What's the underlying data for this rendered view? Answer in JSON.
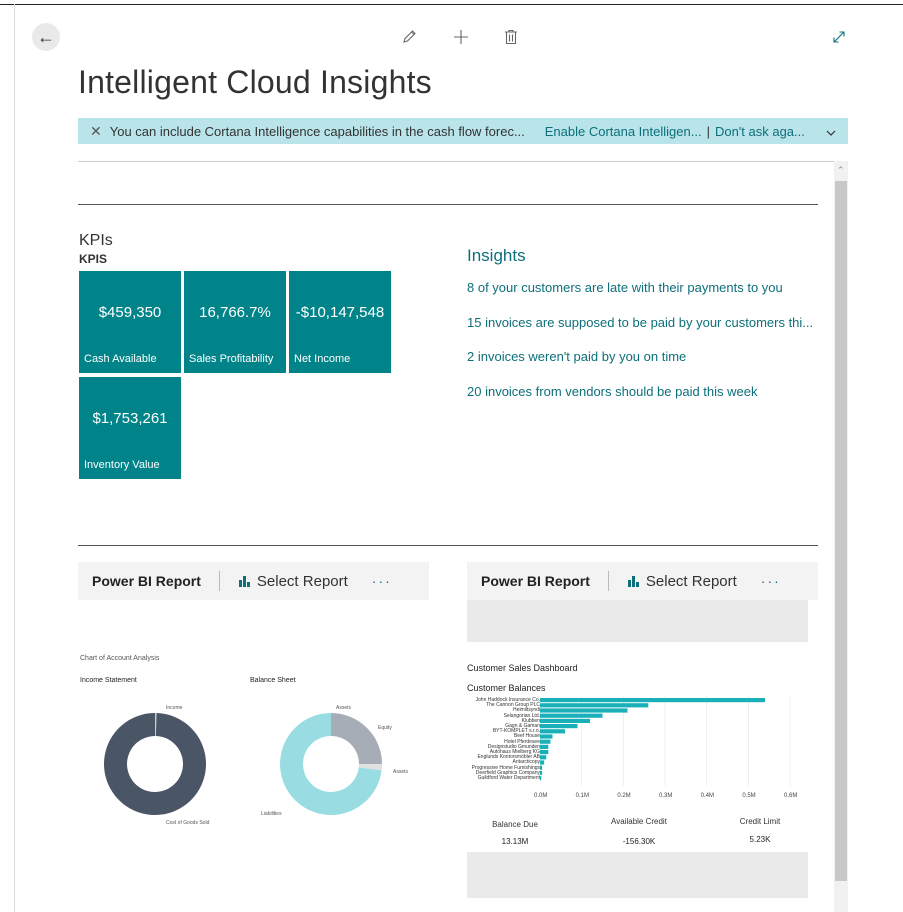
{
  "page": {
    "title": "Intelligent Cloud Insights"
  },
  "banner": {
    "message": "You can include Cortana Intelligence capabilities in the cash flow forec...",
    "enable_label": "Enable Cortana Intelligen...",
    "separator": "|",
    "dont_ask_label": "Don't ask aga..."
  },
  "kpis": {
    "heading": "KPIs",
    "subheading": "KPIS",
    "tiles": [
      {
        "value": "$459,350",
        "label": "Cash Available"
      },
      {
        "value": "16,766.7%",
        "label": "Sales Profitability"
      },
      {
        "value": "-$10,147,548",
        "label": "Net Income"
      },
      {
        "value": "$1,753,261",
        "label": "Inventory Value"
      }
    ]
  },
  "insights": {
    "heading": "Insights",
    "items": [
      "8 of your customers are late with their payments to you",
      "15 invoices are supposed to be paid by your customers thi...",
      "2 invoices weren't paid by you on time",
      "20 invoices from vendors should be paid this week"
    ]
  },
  "powerbi_left": {
    "title": "Power BI Report",
    "select_label": "Select Report",
    "more": "···",
    "report_title": "Chart of Account Analysis",
    "income_title": "Income Statement",
    "balance_title": "Balance Sheet",
    "income_labels": [
      "Income",
      "Cost of Goods Sold"
    ],
    "balance_labels": [
      "Assets",
      "Equity",
      "Assets",
      "Liabilities"
    ]
  },
  "powerbi_right": {
    "title": "Power BI Report",
    "select_label": "Select Report",
    "more": "···",
    "dashboard_title": "Customer Sales Dashboard",
    "chart_title": "Customer Balances",
    "cards": [
      {
        "label": "Balance Due",
        "value": "13.13M"
      },
      {
        "label": "Available Credit",
        "value": "-156.30K"
      },
      {
        "label": "Credit Limit",
        "value": "5.23K"
      }
    ]
  },
  "chart_data": [
    {
      "type": "bar",
      "title": "Customer Balances",
      "orientation": "horizontal",
      "categories": [
        "John Haddock Insurance Co.",
        "The Cannon Group PLC",
        "Heimiltsyndi",
        "Selangorian Ltd.",
        "Klubben",
        "Gagn & Gaman",
        "BYT-KOMPLET s.r.o.",
        "Beef House",
        "Hotel Pferdesee",
        "Designstudio Gmunden",
        "Autohaus Mielberg KG",
        "Englunds Kontorsmöbler AB",
        "Antarcticopy",
        "Progressive Home Furnishings",
        "Deerfield Graphics Company",
        "Guildford Water Department"
      ],
      "values": [
        0.54,
        0.26,
        0.21,
        0.15,
        0.12,
        0.09,
        0.06,
        0.03,
        0.025,
        0.02,
        0.02,
        0.015,
        0.01,
        0.005,
        0.005,
        0.003
      ],
      "xticks": [
        "0.0M",
        "0.1M",
        "0.2M",
        "0.3M",
        "0.4M",
        "0.5M",
        "0.6M"
      ],
      "xlim": [
        0,
        0.6
      ],
      "color": "#1ab0b9"
    },
    {
      "type": "pie",
      "title": "Income Statement",
      "labels": [
        "Income",
        "Cost of Goods Sold"
      ],
      "values": [
        0.5,
        99.5
      ],
      "colors": [
        "#cccccc",
        "#4a5566"
      ]
    },
    {
      "type": "pie",
      "title": "Balance Sheet",
      "labels": [
        "Assets",
        "Equity",
        "Liabilities"
      ],
      "values": [
        25,
        2,
        73
      ],
      "colors": [
        "#a7adb6",
        "#e0e0e0",
        "#99dde3"
      ]
    }
  ]
}
